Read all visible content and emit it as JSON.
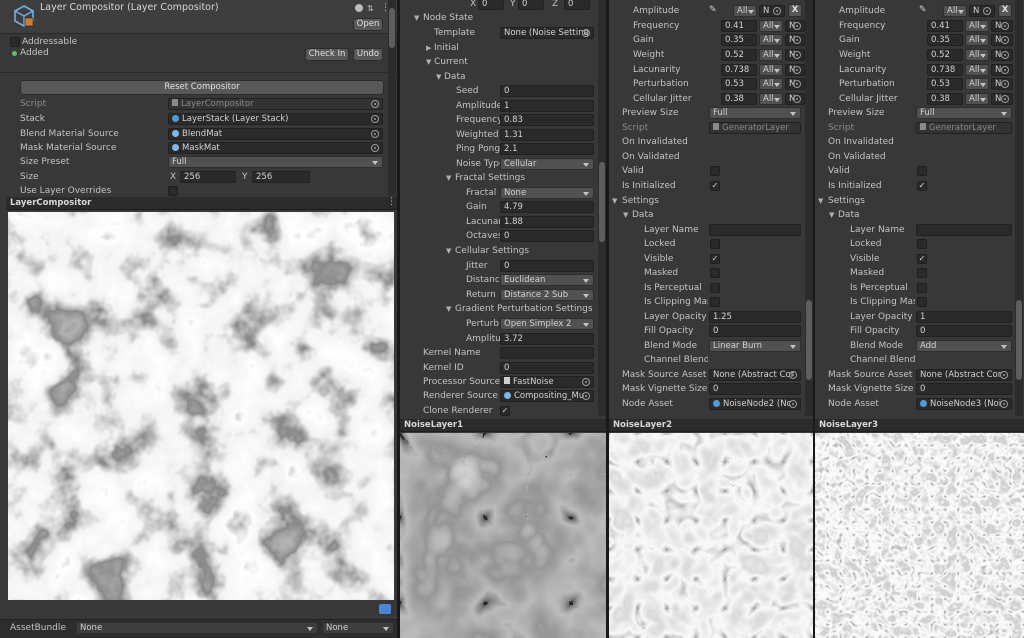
{
  "left_panel": {
    "title": "Layer Compositor (Layer Compositor)",
    "open_label": "Open",
    "addressable_label": "Addressable",
    "added_label": "Added",
    "check_in_label": "Check In",
    "undo_label": "Undo",
    "reset_label": "Reset Compositor",
    "script_label": "Script",
    "script_value": "LayerCompositor",
    "stack_label": "Stack",
    "stack_value": "LayerStack (Layer Stack)",
    "blend_label": "Blend Material Source",
    "blend_value": "BlendMat",
    "mask_label": "Mask Material Source",
    "mask_value": "MaskMat",
    "size_preset_label": "Size Preset",
    "size_preset_value": "Full",
    "size_label": "Size",
    "size_x_label": "X",
    "size_x_value": "256",
    "size_y_label": "Y",
    "size_y_value": "256",
    "overrides_label": "Use Layer Overrides",
    "preview_title": "LayerCompositor",
    "assetbundle_label": "AssetBundle",
    "assetbundle_value": "None",
    "assetbundle_variant": "None"
  },
  "middle_panel": {
    "xyz": [
      {
        "label": "X",
        "value": "0"
      },
      {
        "label": "Y",
        "value": "0"
      },
      {
        "label": "Z",
        "value": "0"
      }
    ],
    "node_state": "Node State",
    "template_label": "Template",
    "template_value": "None (Noise Setting",
    "initial": "Initial",
    "current": "Current",
    "data": "Data",
    "seed_label": "Seed",
    "seed_value": "0",
    "amplitude_label": "Amplitude",
    "amplitude_value": "1",
    "frequency_label": "Frequency",
    "frequency_value": "0.83",
    "weighted_label": "Weighted !",
    "weighted_value": "1.31",
    "pingpong_label": "Ping Pong",
    "pingpong_value": "2.1",
    "noisetype_label": "Noise Type",
    "noisetype_value": "Cellular",
    "fractal_settings": "Fractal Settings",
    "fractal_label": "Fractal",
    "fractal_value": "None",
    "gain_label": "Gain",
    "gain_value": "4.79",
    "lacunarity_label": "Lacunar",
    "lacunarity_value": "1.88",
    "octaves_label": "Octaves",
    "octaves_value": "0",
    "cellular_settings": "Cellular Settings",
    "jitter_label": "Jitter",
    "jitter_value": "0",
    "distance_label": "Distance",
    "distance_value": "Euclidean",
    "return_label": "Return",
    "return_value": "Distance 2 Sub",
    "gradient_settings": "Gradient Perturbation Settings",
    "perturb_label": "Perturb",
    "perturb_value": "Open Simplex 2",
    "amplitude2_label": "Amplitu",
    "amplitude2_value": "3.72",
    "kernel_name_label": "Kernel Name",
    "kernel_name_value": "",
    "kernel_id_label": "Kernel ID",
    "kernel_id_value": "0",
    "processor_label": "Processor Source",
    "processor_value": "FastNoise",
    "renderer_label": "Renderer Source",
    "renderer_value": "Compositing_Mu",
    "clone_label": "Clone Renderer",
    "preview_title": "NoiseLayer1"
  },
  "layers": [
    {
      "amplitude_label": "Amplitude",
      "amp_dd": "All",
      "amp_field": "N",
      "frequency_label": "Frequency",
      "frequency_value": "0.41",
      "gain_label": "Gain",
      "gain_value": "0.35",
      "weight_label": "Weight",
      "weight_value": "0.52",
      "lacunarity_label": "Lacunarity",
      "lacunarity_value": "0.738",
      "perturbation_label": "Perturbation",
      "perturbation_value": "0.53",
      "cellular_jitter_label": "Cellular Jitter",
      "cellular_jitter_value": "0.38",
      "preview_size_label": "Preview Size",
      "preview_size_value": "Full",
      "script_label": "Script",
      "script_value": "GeneratorLayer",
      "on_invalidated": "On Invalidated",
      "on_validated": "On Validated",
      "valid_label": "Valid",
      "is_initialized_label": "Is Initialized",
      "settings_label": "Settings",
      "data_label": "Data",
      "layer_name_label": "Layer Name",
      "layer_name_value": "",
      "locked_label": "Locked",
      "visible_label": "Visible",
      "masked_label": "Masked",
      "is_perceptual_label": "Is Perceptual",
      "is_clipping_label": "Is Clipping Mask",
      "layer_opacity_label": "Layer Opacity",
      "layer_opacity_value": "1.25",
      "fill_opacity_label": "Fill Opacity",
      "fill_opacity_value": "0",
      "blend_mode_label": "Blend Mode",
      "blend_mode_value": "Linear Burn",
      "channel_blending_label": "Channel Blending",
      "mask_source_label": "Mask Source Asset",
      "mask_source_value": "None (Abstract Cor",
      "mask_vignette_label": "Mask Vignette Size",
      "mask_vignette_value": "0",
      "node_asset_label": "Node Asset",
      "node_asset_value": "NoiseNode2 (Nc",
      "preview_title": "NoiseLayer2"
    },
    {
      "amplitude_label": "Amplitude",
      "amp_dd": "All",
      "amp_field": "N",
      "frequency_label": "Frequency",
      "frequency_value": "0.41",
      "gain_label": "Gain",
      "gain_value": "0.35",
      "weight_label": "Weight",
      "weight_value": "0.52",
      "lacunarity_label": "Lacunarity",
      "lacunarity_value": "0.738",
      "perturbation_label": "Perturbation",
      "perturbation_value": "0.53",
      "cellular_jitter_label": "Cellular Jitter",
      "cellular_jitter_value": "0.38",
      "preview_size_label": "Preview Size",
      "preview_size_value": "Full",
      "script_label": "Script",
      "script_value": "GeneratorLayer",
      "on_invalidated": "On Invalidated",
      "on_validated": "On Validated",
      "valid_label": "Valid",
      "is_initialized_label": "Is Initialized",
      "settings_label": "Settings",
      "data_label": "Data",
      "layer_name_label": "Layer Name",
      "layer_name_value": "",
      "locked_label": "Locked",
      "visible_label": "Visible",
      "masked_label": "Masked",
      "is_perceptual_label": "Is Perceptual",
      "is_clipping_label": "Is Clipping Mask",
      "layer_opacity_label": "Layer Opacity",
      "layer_opacity_value": "1",
      "fill_opacity_label": "Fill Opacity",
      "fill_opacity_value": "0",
      "blend_mode_label": "Blend Mode",
      "blend_mode_value": "Add",
      "channel_blending_label": "Channel Blending",
      "mask_source_label": "Mask Source Asset",
      "mask_source_value": "None (Abstract Cor",
      "mask_vignette_label": "Mask Vignette Size",
      "mask_vignette_value": "0",
      "node_asset_label": "Node Asset",
      "node_asset_value": "NoiseNode3 (Noi",
      "preview_title": "NoiseLayer3"
    }
  ]
}
